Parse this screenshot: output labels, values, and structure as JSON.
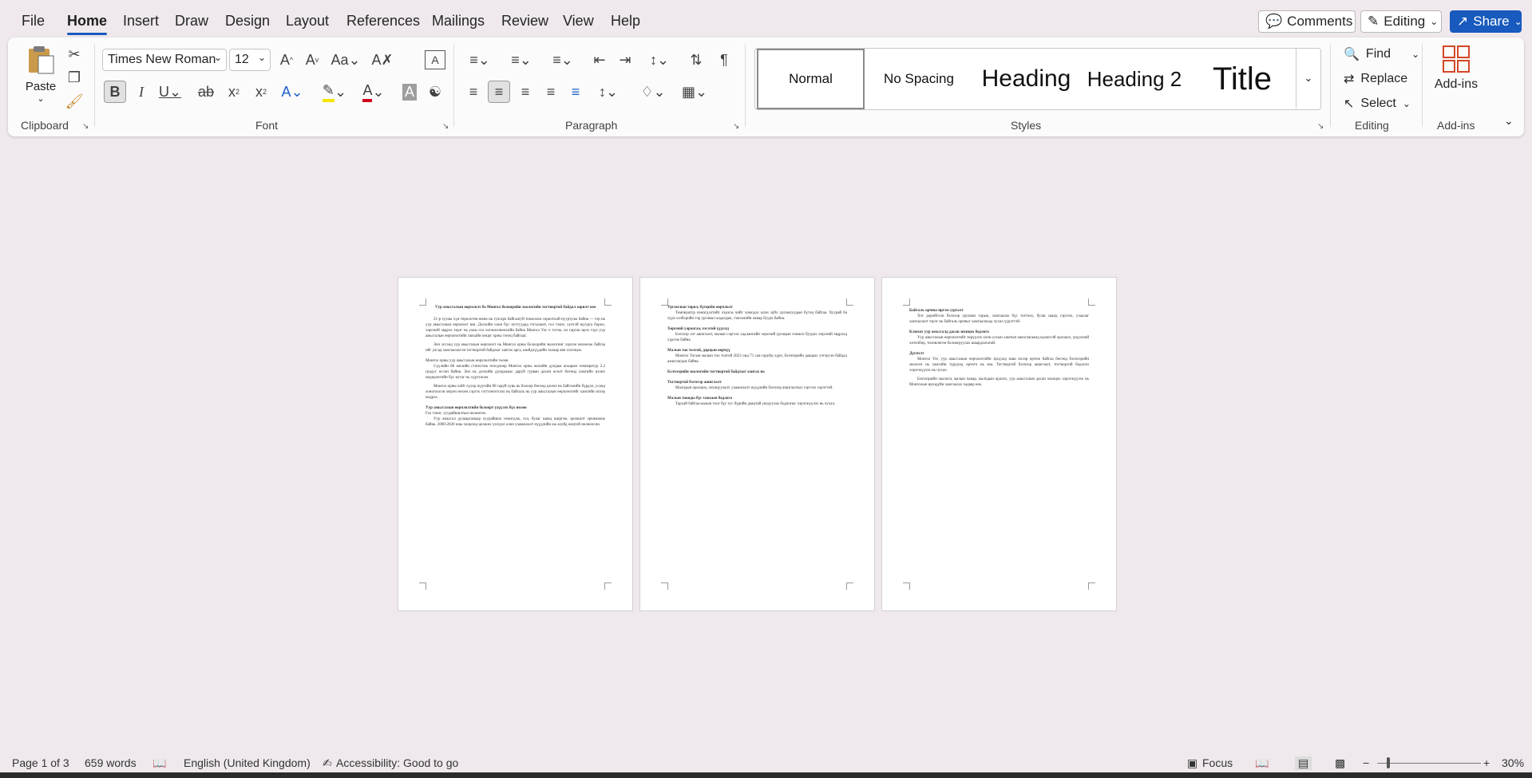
{
  "menu": {
    "tabs": [
      "File",
      "Home",
      "Insert",
      "Draw",
      "Design",
      "Layout",
      "References",
      "Mailings",
      "Review",
      "View",
      "Help"
    ],
    "comments_label": "Comments",
    "editing_label": "Editing",
    "share_label": "Share"
  },
  "ribbon": {
    "clipboard": {
      "paste_label": "Paste",
      "group_label": "Clipboard"
    },
    "font": {
      "name": "Times New Roman",
      "size": "12",
      "group_label": "Font"
    },
    "paragraph": {
      "group_label": "Paragraph"
    },
    "styles": {
      "items": [
        "Normal",
        "No Spacing",
        "Heading",
        "Heading 2",
        "Title"
      ],
      "group_label": "Styles"
    },
    "editing": {
      "find": "Find",
      "replace": "Replace",
      "select": "Select",
      "group_label": "Editing"
    },
    "addins": {
      "label": "Add-ins",
      "group_label": "Add-ins"
    }
  },
  "pages": [
    {
      "title": "Уур амьсгалын өөрчлөлт ба Монгол болоорийн экологийн тогтвортой байдал зорилт юм",
      "paragraphs": [
        "21-р зууны хүн төрөлхтөн өмнө нь тулгарч байгаатуй томоохон сорилтоой нууртулж байна — тэр нь уур амьсгалын өөрчлөлт юм. Дэлхийн олон бүс нутгуудад гэгхалант, гол гэмэг, хүчтэй шуурга бороо, хөрсний эвдрэл зэрэг нь улам гол хөгжихэнөөхийн байна Монгол Улс ч тэгэж, ил гарган ирэх тэдэ уур амьсгалын өөрчлөлтийн тавхайн онцог орны тэнэц байгааг.",
        "Энэ эссэнд уур амьсгалын өөрчлөлт нь Монгол орны болоорийн экологииг хэрхэн нөлөөлж байгаа ийг улсад хамгаалахгэн тогтвортой байдлыг хангах арга, шийдлүүдийн талаар авч хэлэлцэх.",
        "Монгол орны уур амьсгалын өөрчлөлтийн төлөв",
        "Сүүлийн 80 жилийн статистик өгөгдлөөр Монгол орны жилийн дундаж агаарын температур 2.2 градус өссөн байна. Энэ нь дэлхийн дундажаас даруй гурван дахин өсөлт бөгөөд хамгийн ихэнх өндөрлөгийн бүс нутаг нь хүртэлсан.",
        "Монгол орны хийг хүлэр нүүгийн 80 гаруй хувь нь болоор бөгөөд цөлөл нь байгалийн бүрдэл, усанд хоногоосон мэрэн нөхөн сэргэх гэгтээмэгчлэл нь байгаль нь уур амьсгалын өөрчлөлтийг хамгийн ихээр мэдрэх.",
        "Уур амьсгалын өөрчлөлтийн болоорт үзүүлэх бүх нөлөө",
        "Гол гэмэг, хуурайшилтын нөлөөгөө.",
        "Уур амьсгал дулаарсанаар хуурайшил нэмэгдэж, гол, булаг шанд ширгэж, цөлжилт эрчимжиж байна. 2000-2020 оны хооронд цөлжих үзэгдэл олон уламжлалт нүүдлийн аж ахуйд ноцтой нөлөөлсөн."
      ]
    },
    {
      "headings": [
        "Ургамлын төрөл, бүтцийн өөрчлөлт",
        "Хөрсний уараагаа, хэсэгий үүдэлд",
        "Малын тоо толгой, дарцын өөрчүү",
        "Бэлчээрийн экологийн тогтвортой байдлыг хангах нь",
        "Тогтвортой бэлчээр ашиглалт",
        "Малын тоонды бүс тавхаан бодлого"
      ],
      "paragraphs": [
        "Температур нэмэгдэлтийг хэрэгж чийг хомсдол олон зүйл ургамлуудын бүтэц байгаа. Хуурай ба зүүн хэлбэрийн тэр ургамал алдагдаж, тэжээлийн чанар буурч байна.",
        "Бэлчээр хэт ашиглалт, малын сэргээх хадлангийн хөрсний ургацын хэмжээ буурах хөрсний эвдрэлд хүргэж байна.",
        "Монгол Улсын малын тоо толгой 2023 онд 71 сая гаруйд хүрч, бэлчээрийн даацаас хэтэрсэн байдал ажиглагдаж байна.",
        "Малчдын оролцоо, зохицуулалт, уламжлалт нүүдлийн бэлчээр ашиглалтыг сэргээх хэрэгтэй.",
        "Тархай байгаа малын тоог бүс тус бүрийн даацтай уялдуулах бодлогыг хэрэгжүүлэх нь чухал."
      ]
    },
    {
      "headings": [
        "Байгаль орчны иргэн сургалт",
        "Климат уур амьсгалд дасан зохицох бодлого",
        "Дүгнэлт"
      ],
      "paragraphs": [
        "Хэт доройтсон бэлчээр ургамал тарьж, хамгаалах бүс тогтоох, булаг шанд сэргээх, ухаалаг хамгаалалт зэрэг нь байгаль орчныг хамгаалахад чухал үүрэгтэй.",
        "Уур амьсгалын өөрчлөлтийг зөрүүлэх олон улсын хамтын ажиллагаанд идэвхтэй оролцох, үндэсний хөтөлбөр, төлөвлөгөө боловсруулах шаардлагатай.",
        "Монгол Улс уур амьсгалын өөрчлөлтийн эрсдэлд маш ихээр өртөж байгаа бөгөөд бэлчээрийн экологи нь хамгийн түрүүнд өртөгч нь юм. Тогтвортой бэлчээр ашиглалт, тогтвортой бодлого хэрэгжүүлэх нь чухал.",
        "Бэлчээрийн экологи, малын чанар, малчдын орлого, уур амьсгалын дасан зохицох хэрэгжүүлэх нь Монголын ирээдүйн хамгаалах чадвар юм."
      ]
    }
  ],
  "status": {
    "page": "Page 1 of 3",
    "words": "659 words",
    "language": "English (United Kingdom)",
    "accessibility": "Accessibility: Good to go",
    "focus": "Focus",
    "zoom": "30%",
    "zoom_percent": 30
  }
}
